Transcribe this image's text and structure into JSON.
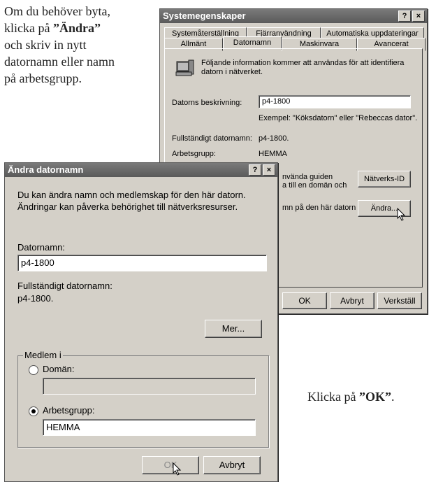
{
  "instructions": {
    "top_line1": "Om du behöver byta,",
    "top_line2_pre": "klicka på ",
    "top_line2_bold": "”Ändra”",
    "top_line3": "och skriv in nytt",
    "top_line4": "datornamn eller namn",
    "top_line5": "på arbetsgrupp.",
    "bottom_pre": "Klicka på ",
    "bottom_bold": "”OK”",
    "bottom_post": "."
  },
  "sys_window": {
    "title": "Systemegenskaper",
    "help": "?",
    "close": "×",
    "tabs_row1": [
      "Systemåterställning",
      "Fjärranvändning",
      "Automatiska uppdateringar"
    ],
    "tabs_row2": [
      "Allmänt",
      "Datornamn",
      "Maskinvara",
      "Avancerat"
    ],
    "info_line1": "Följande information kommer att användas för att identifiera",
    "info_line2": "datorn i nätverket.",
    "desc_label": "Datorns beskrivning:",
    "desc_value": "p4-1800",
    "example": "Exempel: \"Köksdatorn\" eller \"Rebeccas dator\".",
    "fullname_label": "Fullständigt datornamn:",
    "fullname_value": "p4-1800.",
    "workgroup_label": "Arbetsgrupp:",
    "workgroup_value": "HEMMA",
    "wizard_line1": "nvända guiden",
    "wizard_line2": "a till en domän och",
    "network_id_btn": "Nätverks-ID",
    "rename_text": "mn på den här datorn",
    "change_btn": "Ändra...",
    "ok_btn": "OK",
    "cancel_btn": "Avbryt",
    "apply_btn": "Verkställ"
  },
  "change_dialog": {
    "title": "Ändra datornamn",
    "help": "?",
    "close": "×",
    "intro_line1": "Du kan ändra namn och medlemskap för den här datorn.",
    "intro_line2": "Ändringar kan påverka behörighet till nätverksresurser.",
    "name_label": "Datornamn:",
    "name_value": "p4-1800",
    "fullname_label": "Fullständigt datornamn:",
    "fullname_value": "p4-1800.",
    "more_btn": "Mer...",
    "member_group": "Medlem i",
    "domain_label": "Domän:",
    "domain_value": "",
    "workgroup_label": "Arbetsgrupp:",
    "workgroup_value": "HEMMA",
    "selected": "Arbetsgrupp",
    "ok_btn": "OK",
    "cancel_btn": "Avbryt"
  }
}
